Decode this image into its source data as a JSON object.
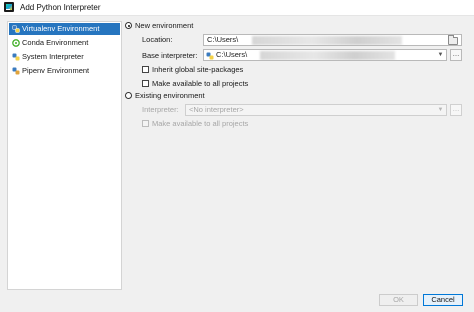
{
  "window": {
    "title": "Add Python Interpreter"
  },
  "sidebar": {
    "items": [
      {
        "label": "Virtualenv Environment",
        "icon": "virtualenv-icon",
        "selected": true
      },
      {
        "label": "Conda Environment",
        "icon": "conda-icon",
        "selected": false
      },
      {
        "label": "System Interpreter",
        "icon": "python-icon",
        "selected": false
      },
      {
        "label": "Pipenv Environment",
        "icon": "pipenv-icon",
        "selected": false
      }
    ]
  },
  "new_env": {
    "radio_label": "New environment",
    "location_label": "Location:",
    "location_value": "C:\\Users\\",
    "base_label": "Base interpreter:",
    "base_value": "C:\\Users\\",
    "inherit_label": "Inherit global site-packages",
    "available_label": "Make available to all projects"
  },
  "existing_env": {
    "radio_label": "Existing environment",
    "interpreter_label": "Interpreter:",
    "interpreter_value": "<No interpreter>",
    "available_label": "Make available to all projects"
  },
  "footer": {
    "ok_label": "OK",
    "cancel_label": "Cancel"
  },
  "colors": {
    "selection": "#2675bf",
    "accent_border": "#0078d7"
  }
}
